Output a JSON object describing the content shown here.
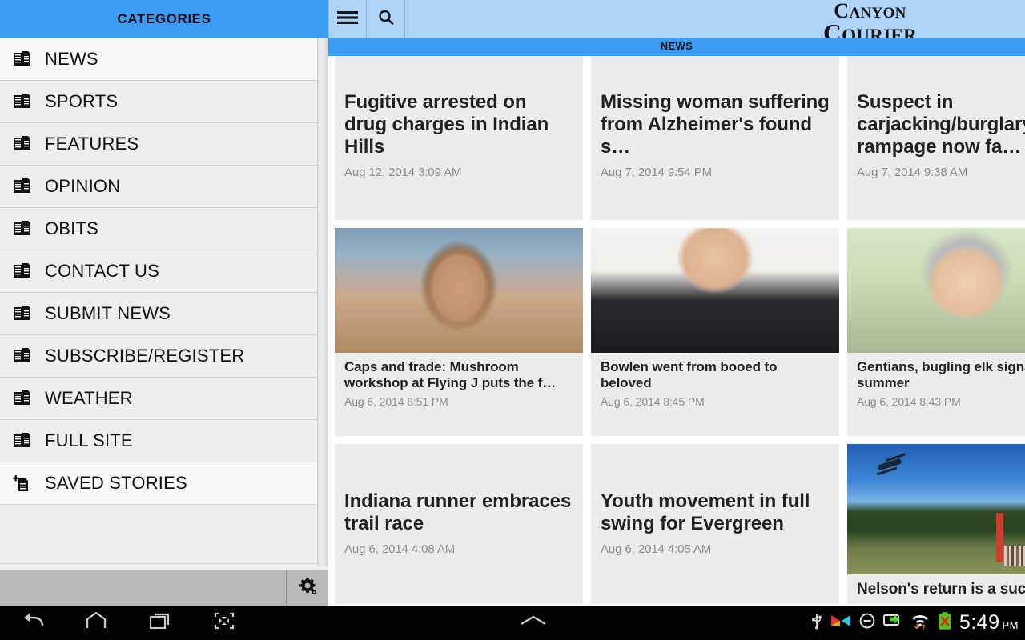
{
  "drawer": {
    "title": "CATEGORIES",
    "items": [
      {
        "label": "NEWS",
        "icon": "documents-icon",
        "selected": true
      },
      {
        "label": "SPORTS",
        "icon": "documents-icon",
        "selected": false
      },
      {
        "label": "FEATURES",
        "icon": "documents-icon",
        "selected": false
      },
      {
        "label": "OPINION",
        "icon": "documents-icon",
        "selected": false
      },
      {
        "label": "OBITS",
        "icon": "documents-icon",
        "selected": false
      },
      {
        "label": "CONTACT US",
        "icon": "documents-icon",
        "selected": false
      },
      {
        "label": "SUBMIT NEWS",
        "icon": "documents-icon",
        "selected": false
      },
      {
        "label": "SUBSCRIBE/REGISTER",
        "icon": "documents-icon",
        "selected": false
      },
      {
        "label": "WEATHER",
        "icon": "documents-icon",
        "selected": false
      },
      {
        "label": "FULL SITE",
        "icon": "documents-icon",
        "selected": false
      },
      {
        "label": "SAVED STORIES",
        "icon": "document-add-icon",
        "selected": true
      }
    ],
    "footer": {
      "settings_icon": "gear-icon"
    }
  },
  "appbar": {
    "menu_icon": "hamburger-menu-icon",
    "search_icon": "search-icon",
    "logo_line1": "CANYON",
    "logo_line2": "COURIER",
    "logo_line1_cap": "C",
    "logo_line1_rest": "ANYON",
    "logo_line2_cap": "C",
    "logo_line2_rest": "OURIER"
  },
  "tabbar": {
    "active_tab": "NEWS"
  },
  "colors": {
    "accent_blue": "#3b9cf4",
    "appbar_blue": "#aed5f7",
    "card_bg": "#ececec",
    "date_gray": "#8d8d8d"
  },
  "articles": {
    "row1": [
      {
        "title": "Fugitive arrested on drug charges in Indian Hills",
        "date": "Aug 12, 2014 3:09 AM"
      },
      {
        "title": "Missing woman suffering from Alzheimer's found s…",
        "date": "Aug 7, 2014 9:54 PM"
      },
      {
        "title": "Suspect in carjacking/burglary rampage now fa…",
        "date": "Aug 7, 2014 9:38 AM"
      }
    ],
    "row2": [
      {
        "title": "Caps and trade: Mushroom workshop at Flying J puts the f…",
        "date": "Aug 6, 2014 8:51 PM",
        "photo": "girl-photo"
      },
      {
        "title": "Bowlen went from booed to beloved",
        "date": "Aug 6, 2014 8:45 PM",
        "photo": "man-photo"
      },
      {
        "title": "Gentians, bugling elk signal end of summer",
        "date": "Aug 6, 2014 8:43 PM",
        "photo": "woman-photo"
      }
    ],
    "row3": [
      {
        "title": "Indiana runner embraces trail race",
        "date": "Aug 6, 2014 4:08 AM"
      },
      {
        "title": "Youth movement in full swing for Evergreen",
        "date": "Aug 6, 2014 4:05 AM"
      },
      {
        "title": "Nelson's return is a success",
        "date": "",
        "photo": "helicopter-race-photo"
      }
    ]
  },
  "navbar": {
    "back_icon": "back-arrow-icon",
    "home_icon": "home-icon",
    "recents_icon": "recent-apps-icon",
    "screenshot_icon": "screenshot-icon",
    "expand_icon": "chevron-up-icon",
    "status_icons": [
      "usb-icon",
      "media-bowtie-icon",
      "do-not-disturb-icon",
      "screen-share-icon",
      "wifi-icon",
      "battery-error-icon"
    ],
    "clock_time": "5:49",
    "clock_ampm": "PM"
  }
}
